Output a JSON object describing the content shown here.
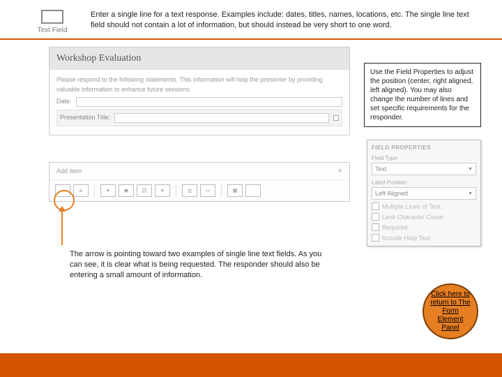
{
  "header": {
    "icon_label": "Text Field",
    "description": "Enter a single line for a text response. Examples include: dates, titles, names, locations, etc. The single line text field should not contain a lot of information, but should instead be very short to one word."
  },
  "form": {
    "title": "Workshop Evaluation",
    "intro": "Please respond to the following statements. This information will help the presenter by providing valuable information to enhance future sessions.",
    "row1_label": "Date:",
    "row2_label": "Presentation Title:"
  },
  "toolbar": {
    "add_item": "Add Item"
  },
  "callout": {
    "text": "Use the Field Properties to adjust the position (center, right aligned, left aligned). You may also change the number of lines and set specific requirements for the responder."
  },
  "props": {
    "header": "FIELD PROPERTIES",
    "field_type_label": "Field Type",
    "field_type_value": "Text",
    "label_pos_label": "Label Position",
    "label_pos_value": "Left Aligned",
    "chk1": "Multiple Lines of Text",
    "chk2": "Limit Character Count",
    "chk3": "Required",
    "chk4": "Include Help Text"
  },
  "arrow_caption": "The arrow is pointing toward two examples of single line text fields. As you can see, it is clear what is being requested. The responder should also be entering a small amount of information.",
  "return_link": "Click here to return to The Form Element Panel"
}
